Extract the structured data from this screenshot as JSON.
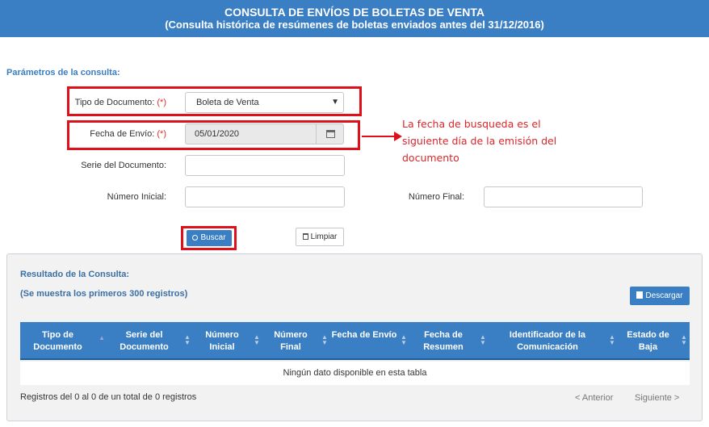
{
  "header": {
    "title": "CONSULTA DE ENVÍOS DE BOLETAS DE VENTA",
    "subtitle": "(Consulta histórica de resúmenes de boletas enviados antes del 31/12/2016)"
  },
  "params": {
    "section_title": "Parámetros de la consulta:",
    "required_mark": "(*)",
    "tipo_label": "Tipo de Documento:",
    "tipo_value": "Boleta de Venta",
    "fecha_label": "Fecha de Envío:",
    "fecha_value": "05/01/2020",
    "serie_label": "Serie del Documento:",
    "serie_value": "",
    "num_inicial_label": "Número Inicial:",
    "num_inicial_value": "",
    "num_final_label": "Número Final:",
    "num_final_value": ""
  },
  "annotation": {
    "text": "La fecha de busqueda es el siguiente día de la emisión del documento",
    "color": "#d9262a"
  },
  "buttons": {
    "buscar": "Buscar",
    "limpiar": "Limpiar",
    "descargar": "Descargar"
  },
  "results": {
    "title": "Resultado de la Consulta:",
    "subtitle": "(Se muestra los primeros 300 registros)",
    "columns": [
      "Tipo de Documento",
      "Serie del Documento",
      "Número Inicial",
      "Número Final",
      "Fecha de Envío",
      "Fecha de Resumen",
      "Identificador de la Comunicación",
      "Estado de Baja"
    ],
    "empty_message": "Ningún dato disponible en esta tabla",
    "info": "Registros del 0 al 0 de un total de 0 registros",
    "prev": "< Anterior",
    "next": "Siguiente >"
  },
  "colors": {
    "primary": "#3a7ec3",
    "highlight_border": "#e0101b",
    "required": "#d9312b"
  }
}
